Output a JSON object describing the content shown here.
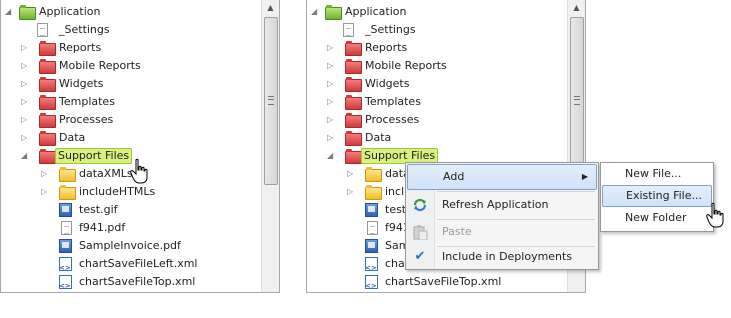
{
  "tree": {
    "root": "Application",
    "items": [
      {
        "label": "_Settings",
        "icon": "document-icon"
      },
      {
        "label": "Reports",
        "icon": "red-folder-icon"
      },
      {
        "label": "Mobile Reports",
        "icon": "red-folder-icon"
      },
      {
        "label": "Widgets",
        "icon": "red-folder-icon"
      },
      {
        "label": "Templates",
        "icon": "red-folder-icon"
      },
      {
        "label": "Processes",
        "icon": "red-folder-icon"
      },
      {
        "label": "Data",
        "icon": "red-folder-icon"
      },
      {
        "label": "Support Files",
        "icon": "red-folder-icon",
        "selected": true
      },
      {
        "label": "dataXMLs",
        "icon": "yellow-folder-icon"
      },
      {
        "label": "includeHTMLs",
        "icon": "yellow-folder-icon"
      },
      {
        "label": "test.gif",
        "icon": "image-file-icon"
      },
      {
        "label": "f941.pdf",
        "icon": "pdf-file-icon"
      },
      {
        "label": "SampleInvoice.pdf",
        "icon": "pdf-file-icon"
      },
      {
        "label": "chartSaveFileLeft.xml",
        "icon": "xml-file-icon"
      },
      {
        "label": "chartSaveFileTop.xml",
        "icon": "xml-file-icon"
      }
    ],
    "right_truncated": [
      "data",
      "inclu",
      "test",
      "f941",
      "Samp",
      "char"
    ]
  },
  "context_menu": {
    "add": "Add",
    "refresh": "Refresh Application",
    "paste": "Paste",
    "include": "Include in Deployments"
  },
  "submenu": {
    "new_file": "New File...",
    "existing_file": "Existing File...",
    "new_folder": "New Folder"
  },
  "colors": {
    "selection_bg": "#d9f27f",
    "menu_highlight": "#cfe2f8",
    "folder_red": "#d13a3a",
    "folder_yellow": "#f2bf2a",
    "root_folder_green": "#6fb32e"
  }
}
